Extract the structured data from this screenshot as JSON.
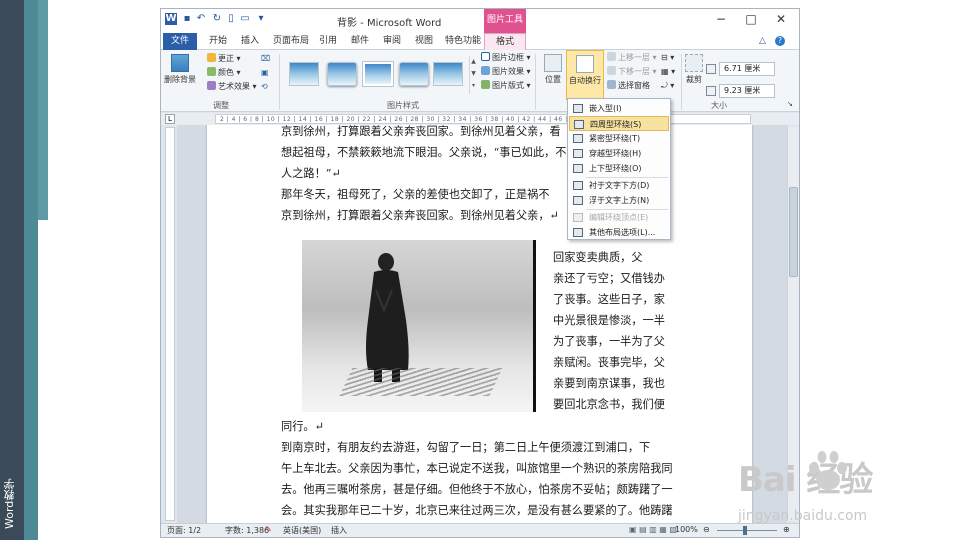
{
  "slide": {
    "side_label": "Word教学",
    "colors": {
      "dark": "#3b4a58",
      "teal": "#4e8a95"
    }
  },
  "window": {
    "title": "背影 - Microsoft Word",
    "context_tab": "图片工具",
    "controls": [
      "−",
      "□",
      "✕"
    ]
  },
  "tabs": [
    "文件",
    "开始",
    "插入",
    "页面布局",
    "引用",
    "邮件",
    "审阅",
    "视图",
    "特色功能",
    "格式"
  ],
  "ribbon": {
    "adjust": {
      "remove_bg": "删除背景",
      "corrections": "更正",
      "color": "颜色",
      "artistic": "艺术效果",
      "label": "调整"
    },
    "picture_styles": {
      "label": "图片样式",
      "border": "图片边框",
      "effects": "图片效果",
      "layout": "图片版式"
    },
    "arrange": {
      "position": "位置",
      "wrap_text": "自动换行",
      "bring_forward": "上移一层",
      "send_backward": "下移一层",
      "selection_pane": "选择窗格"
    },
    "size": {
      "crop": "裁剪",
      "height": "6.71 厘米",
      "width": "9.23 厘米",
      "label": "大小"
    }
  },
  "ruler_text": "2 | 4 | 6 | 8 | 10 | 12 | 14 | 16 | 18 | 20 | 22 | 24 | 26 | 28 | 30 | 32 | 34 | 36 | 38 | 40 | 42 | 44 | 46 | 48",
  "document": {
    "para1": [
      "京到徐州，打算跟着父亲奔丧回家。到徐州见着父亲，看",
      "想起祖母，不禁簌簌地流下眼泪。父亲说，“事已如此，不",
      "人之路！”↵"
    ],
    "para2": [
      "    那年冬天，祖母死了，父亲的差使也交卸了，正是祸不",
      "京到徐州，打算跟着父亲奔丧回家。到徐州见着父亲，↵"
    ],
    "wrap": [
      "  回家变卖典质，父",
      "亲还了亏空；又借钱办",
      "了丧事。这些日子，家",
      "中光景很是惨淡，一半",
      "为了丧事，一半为了父",
      "亲赋闲。丧事完毕，父",
      "亲要到南京谋事，我也",
      "要回北京念书，我们便"
    ],
    "after_figure": "同行。↵",
    "para3": [
      "    到南京时，有朋友约去游逛，勾留了一日；第二日上午便须渡江到浦口，下",
      "午上车北去。父亲因为事忙，本已说定不送我，叫旅馆里一个熟识的茶房陪我同",
      "去。他再三嘱咐茶房，甚是仔细。但他终于不放心，怕茶房不妥帖；颇踌躇了一",
      "会。其实我那年已二十岁，北京已来往过两三次，是没有甚么要紧的了。他踌躇"
    ]
  },
  "wrap_menu": {
    "items": [
      {
        "label": "嵌入型(I)",
        "state": "normal"
      },
      {
        "label": "四周型环绕(S)",
        "state": "highlighted"
      },
      {
        "label": "紧密型环绕(T)",
        "state": "normal"
      },
      {
        "label": "穿越型环绕(H)",
        "state": "normal"
      },
      {
        "label": "上下型环绕(O)",
        "state": "normal"
      },
      {
        "label": "衬于文字下方(D)",
        "state": "normal"
      },
      {
        "label": "浮于文字上方(N)",
        "state": "normal"
      },
      {
        "label": "编辑环绕顶点(E)",
        "state": "disabled"
      },
      {
        "label": "其他布局选项(L)...",
        "state": "normal"
      }
    ]
  },
  "status": {
    "page": "页面: 1/2",
    "words": "字数: 1,386",
    "language": "英语(美国)",
    "mode": "插入",
    "zoom": "100%"
  },
  "watermark": {
    "brand": "Bai  经验",
    "url": "jingyan.baidu.com"
  }
}
